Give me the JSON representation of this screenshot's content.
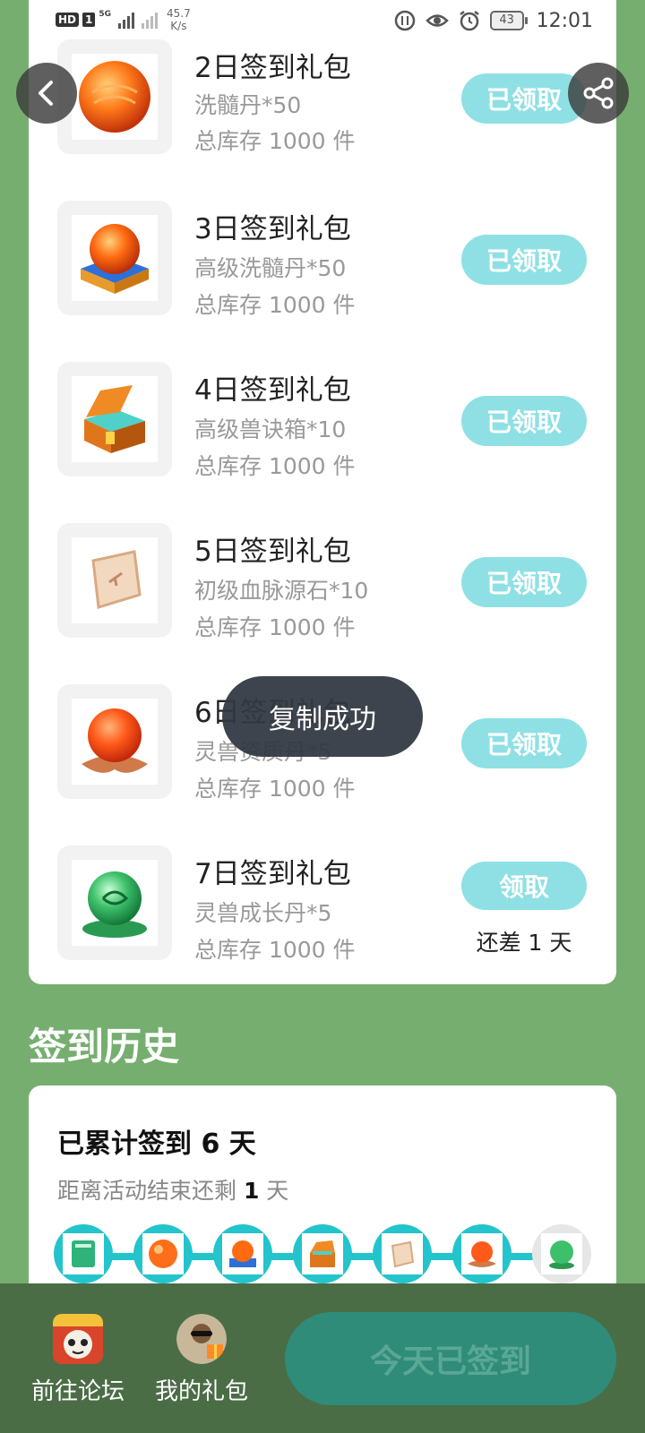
{
  "status_bar": {
    "hd": "HD",
    "sim": "1",
    "network": "5G",
    "speed_value": "45.7",
    "speed_unit": "K/s",
    "battery": "43",
    "time": "12:01"
  },
  "gifts": [
    {
      "title": "2日签到礼包",
      "desc": "洗髓丹*50",
      "stock": "总库存 1000 件",
      "button": "已领取"
    },
    {
      "title": "3日签到礼包",
      "desc": "高级洗髓丹*50",
      "stock": "总库存 1000 件",
      "button": "已领取"
    },
    {
      "title": "4日签到礼包",
      "desc": "高级兽诀箱*10",
      "stock": "总库存 1000 件",
      "button": "已领取"
    },
    {
      "title": "5日签到礼包",
      "desc": "初级血脉源石*10",
      "stock": "总库存 1000 件",
      "button": "已领取"
    },
    {
      "title": "6日签到礼包",
      "desc": "灵兽资质丹*5",
      "stock": "总库存 1000 件",
      "button": "已领取"
    },
    {
      "title": "7日签到礼包",
      "desc": "灵兽成长丹*5",
      "stock": "总库存 1000 件",
      "button": "领取",
      "remaining": "还差 1 天"
    }
  ],
  "toast": "复制成功",
  "history": {
    "title": "签到历史",
    "headline_prefix": "已累计签到 ",
    "days_signed": "6",
    "headline_suffix": " 天",
    "sub_prefix": "距离活动结束还剩 ",
    "days_left": "1",
    "sub_suffix": " 天"
  },
  "bottom": {
    "forum": "前往论坛",
    "my_gifts": "我的礼包",
    "signed": "今天已签到"
  },
  "colors": {
    "background": "#76ae6f",
    "accent_teal": "#23c4cc",
    "claimed_button": "#8fe0e4",
    "bottom_bar": "#4b6d46",
    "signed_button": "#2f8c78"
  }
}
